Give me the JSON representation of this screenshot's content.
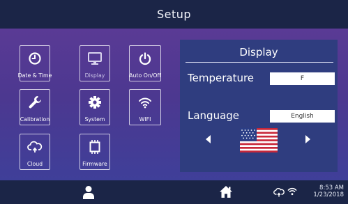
{
  "header": {
    "title": "Setup"
  },
  "tiles": [
    {
      "label": "Date & Time",
      "icon": "clock-icon"
    },
    {
      "label": "Display",
      "icon": "monitor-icon",
      "selected": true
    },
    {
      "label": "Auto On/Off",
      "icon": "power-icon"
    },
    {
      "label": "Calibration",
      "icon": "wrench-icon"
    },
    {
      "label": "System",
      "icon": "gear-icon"
    },
    {
      "label": "WIFI",
      "icon": "wifi-icon"
    },
    {
      "label": "Cloud",
      "icon": "cloud-sync-icon"
    },
    {
      "label": "Firmware",
      "icon": "chip-icon"
    }
  ],
  "panel": {
    "title": "Display",
    "temperature": {
      "label": "Temperature",
      "value": "F"
    },
    "language": {
      "label": "Language",
      "value": "English"
    },
    "flag": "us-flag"
  },
  "statusbar": {
    "user_icon": "user-icon",
    "home_icon": "home-icon",
    "cloud_icon": "cloud-sync-icon",
    "wifi_icon": "wifi-icon",
    "time": "8:53 AM",
    "date": "1/23/2018"
  },
  "colors": {
    "bar": "#1b2547",
    "panel": "#2f3d7f",
    "gradient_top": "#5a3a95",
    "gradient_bottom": "#3f3f99"
  }
}
